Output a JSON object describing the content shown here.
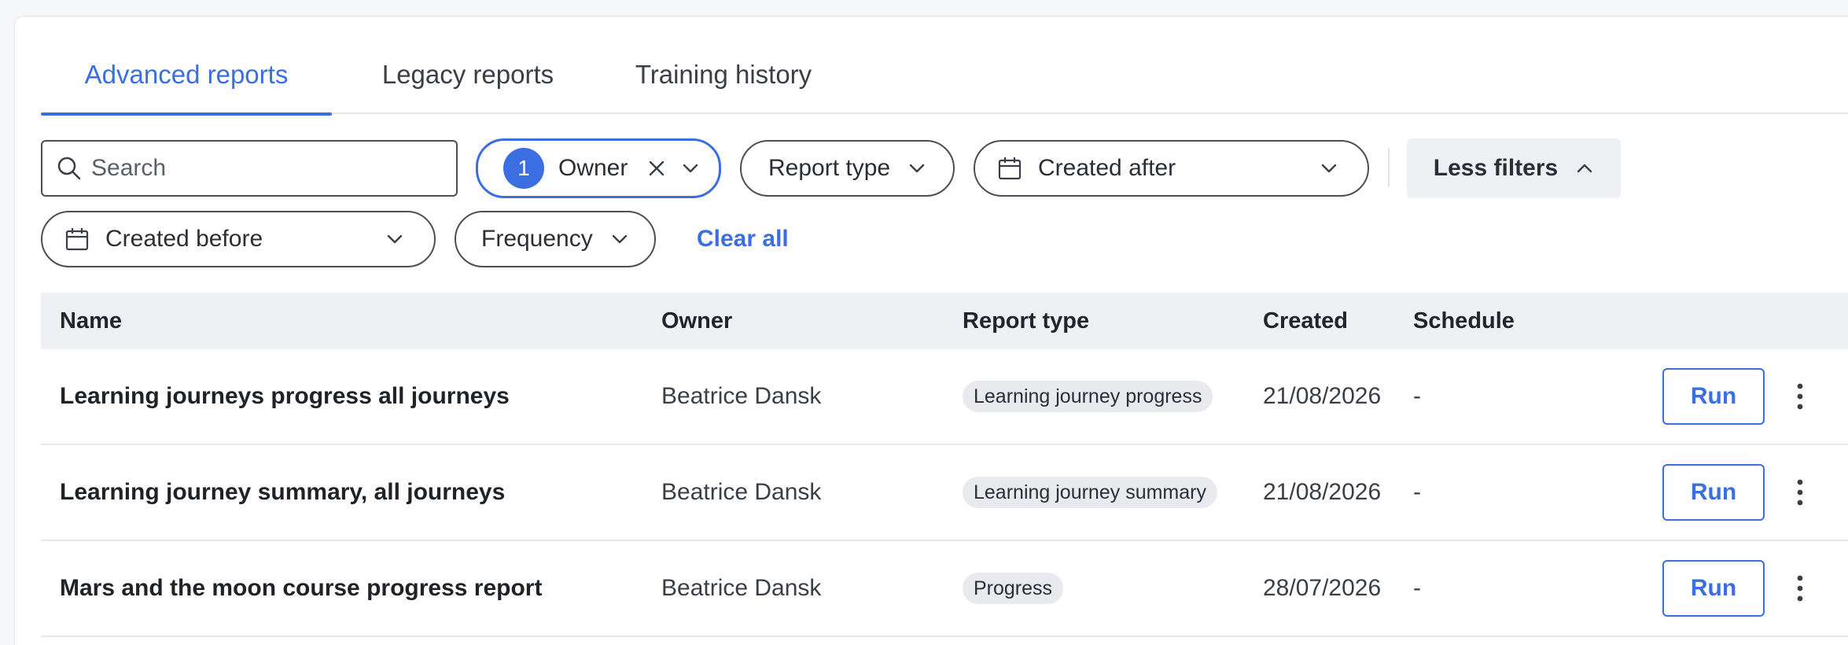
{
  "tabs": [
    {
      "label": "Advanced reports",
      "active": true
    },
    {
      "label": "Legacy reports",
      "active": false
    },
    {
      "label": "Training history",
      "active": false
    }
  ],
  "filters": {
    "search_placeholder": "Search",
    "owner": {
      "count": "1",
      "label": "Owner"
    },
    "report_type": "Report type",
    "created_after": "Created after",
    "less_filters": "Less filters",
    "created_before": "Created before",
    "frequency": "Frequency",
    "clear_all": "Clear all"
  },
  "table": {
    "columns": [
      "Name",
      "Owner",
      "Report type",
      "Created",
      "Schedule"
    ],
    "rows": [
      {
        "name": "Learning journeys progress all journeys",
        "owner": "Beatrice Dansk",
        "type": "Learning journey progress",
        "created": "21/08/2026",
        "schedule": "-",
        "action": "Run"
      },
      {
        "name": "Learning journey summary, all journeys",
        "owner": "Beatrice Dansk",
        "type": "Learning journey summary",
        "created": "21/08/2026",
        "schedule": "-",
        "action": "Run"
      },
      {
        "name": "Mars and the moon course progress report",
        "owner": "Beatrice Dansk",
        "type": "Progress",
        "created": "28/07/2026",
        "schedule": "-",
        "action": "Run"
      }
    ]
  },
  "colors": {
    "accent": "#3b6ee0",
    "header_bg": "#eef0f3",
    "tag_bg": "#e8eaee"
  }
}
